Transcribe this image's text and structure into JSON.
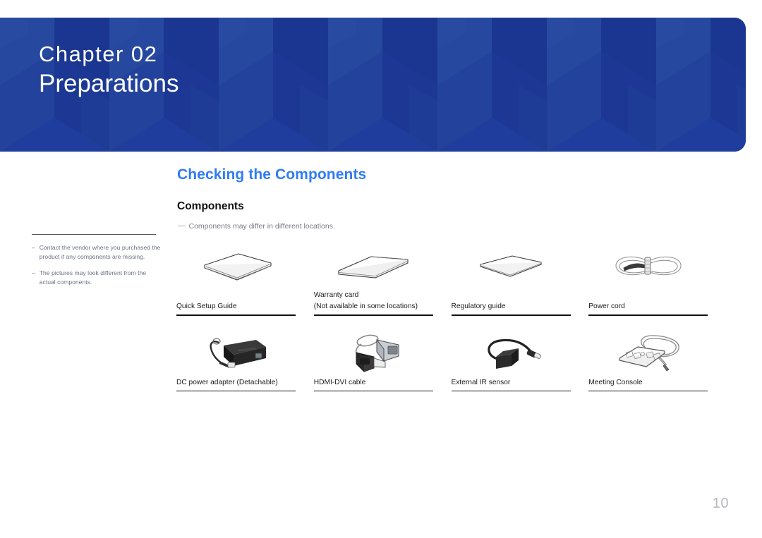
{
  "banner": {
    "chapter_label": "Chapter  02",
    "chapter_title": "Preparations",
    "bg_color": "#1e3d9c"
  },
  "headings": {
    "section_title": "Checking the Components",
    "sub_title": "Components",
    "accent_color": "#2f7cf6"
  },
  "top_note": {
    "dash": "—",
    "text": "Components may differ in different locations."
  },
  "side_notes": {
    "dash": "–",
    "items": [
      "Contact the vendor where you purchased the product if any components are missing.",
      "The pictures may look different from the actual components."
    ]
  },
  "components": {
    "row1": [
      {
        "icon": "booklet-icon",
        "label": "Quick Setup Guide",
        "sublabel": ""
      },
      {
        "icon": "card-stack-icon",
        "label": "Warranty card",
        "sublabel": "(Not available in some locations)"
      },
      {
        "icon": "flat-sheet-icon",
        "label": "Regulatory guide",
        "sublabel": ""
      },
      {
        "icon": "coiled-cable-icon",
        "label": "Power cord",
        "sublabel": ""
      }
    ],
    "row2": [
      {
        "icon": "power-adapter-icon",
        "label": "DC power adapter (Detachable)",
        "sublabel": ""
      },
      {
        "icon": "hdmi-dvi-cable-icon",
        "label": "HDMI-DVI cable",
        "sublabel": ""
      },
      {
        "icon": "ir-sensor-icon",
        "label": "External IR sensor",
        "sublabel": ""
      },
      {
        "icon": "meeting-console-icon",
        "label": "Meeting Console",
        "sublabel": ""
      }
    ]
  },
  "footer": {
    "page_number": "10"
  }
}
